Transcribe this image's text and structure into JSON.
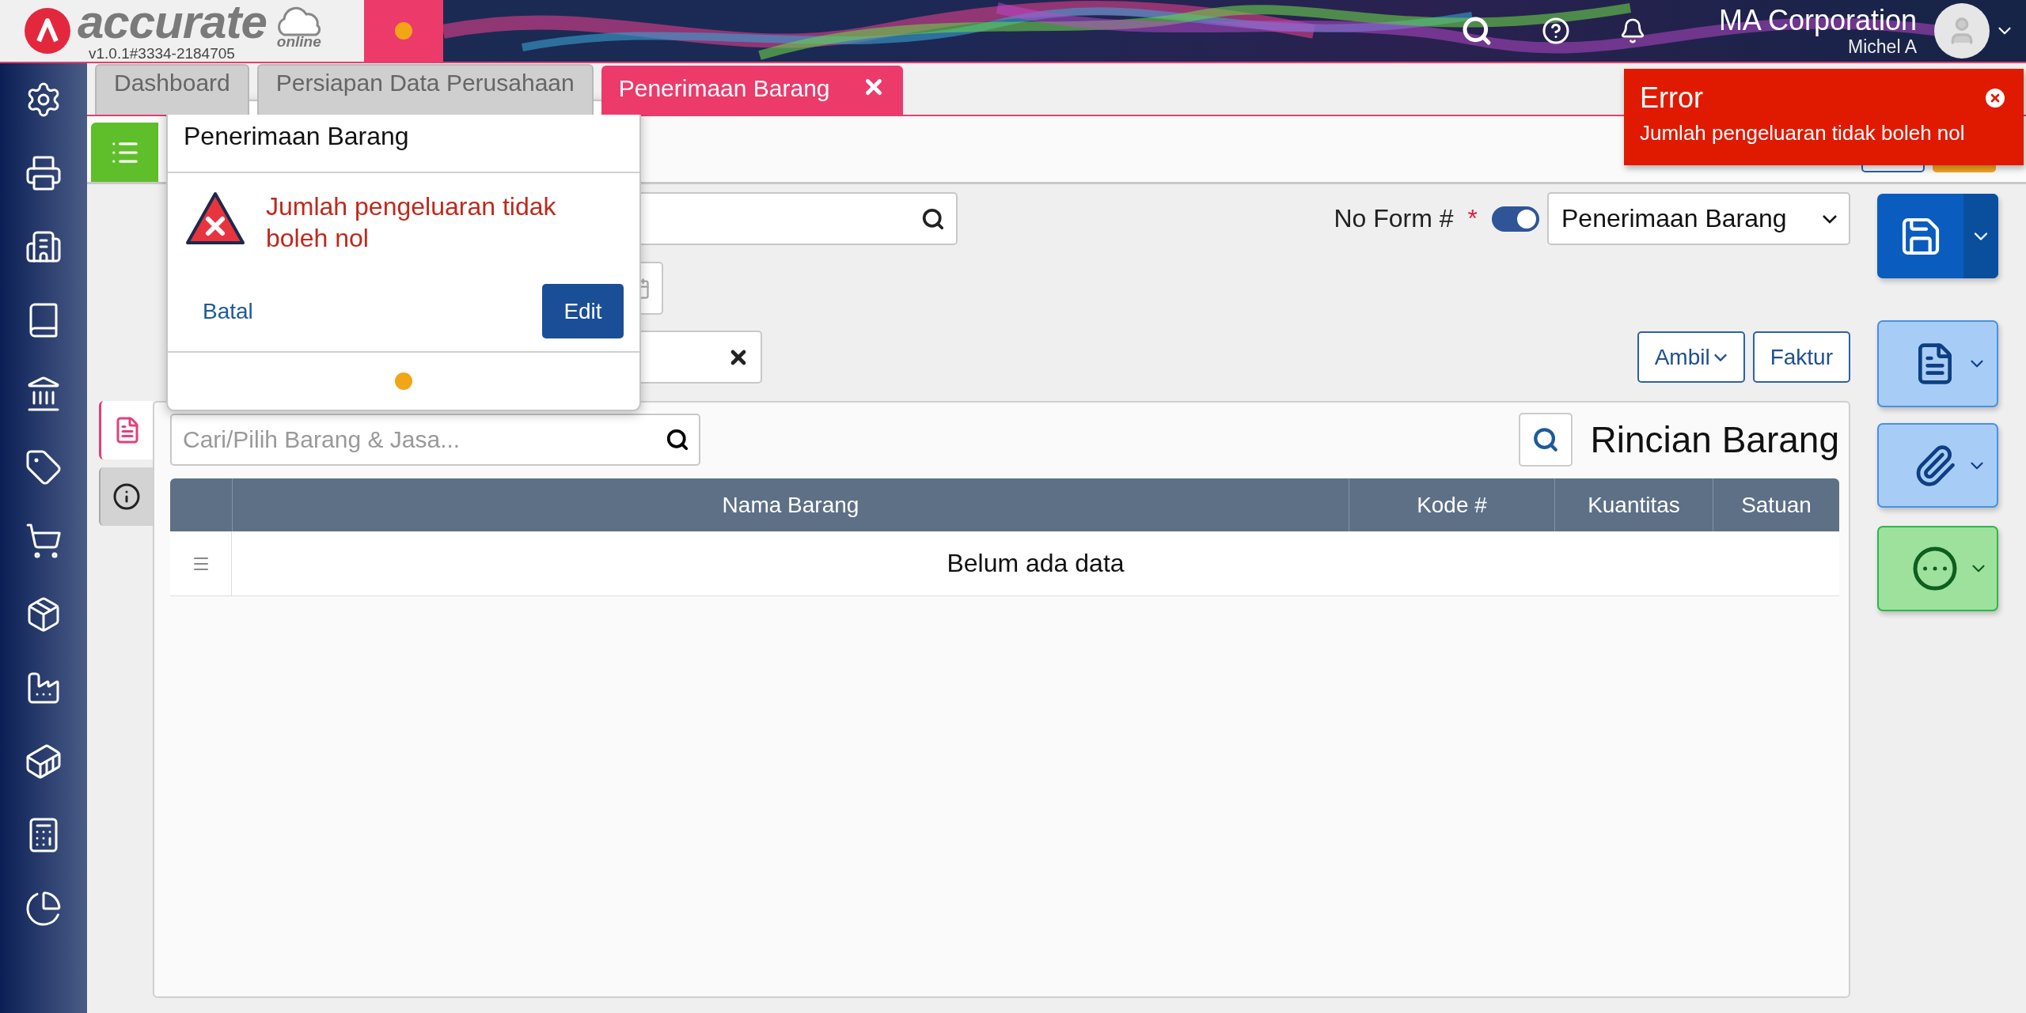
{
  "header": {
    "logo": "accurate",
    "logo_sub": "online",
    "version": "v1.0.1#3334-2184705",
    "company": "MA Corporation",
    "user": "Michel A"
  },
  "tabs": [
    {
      "label": "Dashboard",
      "selected": false,
      "closable": false
    },
    {
      "label": "Persiapan Data Perusahaan",
      "selected": false,
      "closable": false
    },
    {
      "label": "Penerimaan Barang",
      "selected": true,
      "closable": true
    }
  ],
  "form": {
    "no_form_label": "No Form #",
    "required_mark": "*",
    "auto_number": {
      "on": true
    },
    "form_type": "Penerimaan Barang",
    "actions": [
      {
        "label": "Ambil",
        "dropdown": true
      },
      {
        "label": "Faktur",
        "dropdown": false
      }
    ]
  },
  "side_tabs": [
    {
      "kind": "document",
      "selected": true
    },
    {
      "kind": "info",
      "selected": false
    }
  ],
  "details": {
    "search": {
      "placeholder": "Cari/Pilih Barang & Jasa..."
    },
    "title": "Rincian Barang",
    "columns": [
      "Nama Barang",
      "Kode #",
      "Kuantitas",
      "Satuan"
    ],
    "empty": "Belum ada data"
  },
  "dialog": {
    "title": "Penerimaan Barang",
    "message": "Jumlah pengeluaran tidak boleh nol",
    "cancel": "Batal",
    "confirm": "Edit"
  },
  "toast": {
    "title": "Error",
    "message": "Jumlah pengeluaran tidak boleh nol"
  }
}
